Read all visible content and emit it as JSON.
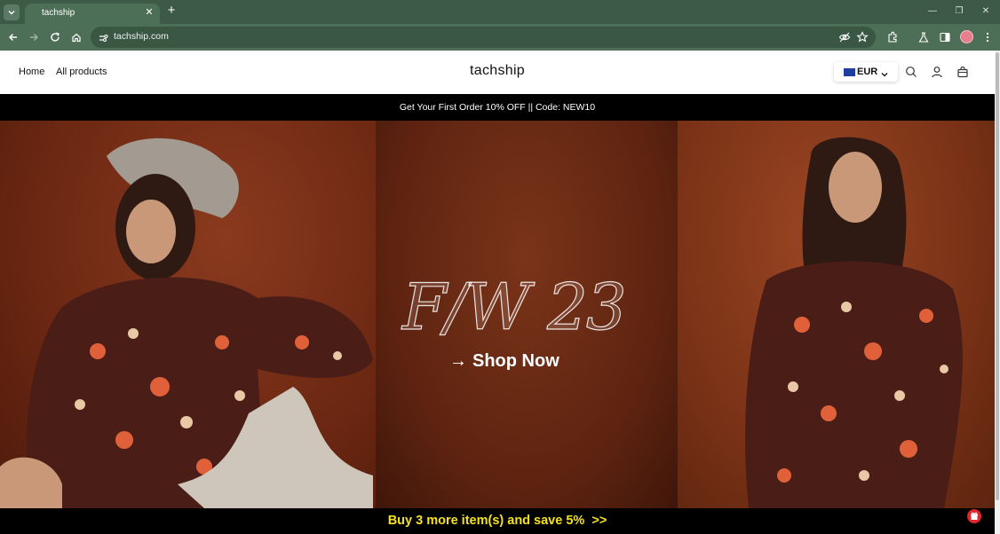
{
  "browser": {
    "tab_title": "tachship",
    "url": "tachship.com"
  },
  "header": {
    "nav": [
      "Home",
      "All products"
    ],
    "brand": "tachship",
    "currency": "EUR"
  },
  "announcement": "Get Your First Order 10% OFF || Code: NEW10",
  "hero": {
    "title": "F/W 23",
    "cta_arrow": "→",
    "cta": "Shop Now"
  },
  "promo_bar": "Buy 3 more item(s) and save 5%  >>",
  "colors": {
    "chrome": "#4d6f57",
    "promo_text": "#f4e11c",
    "hero_bg": "#6b2a17",
    "gift_button": "#e0262b"
  },
  "icons": [
    "tab-list-icon",
    "close-icon",
    "plus-icon",
    "minimize-icon",
    "restore-icon",
    "back-icon",
    "forward-icon",
    "reload-icon",
    "home-icon",
    "site-info-icon",
    "eye-off-icon",
    "star-icon",
    "extensions-icon",
    "labs-icon",
    "side-panel-icon",
    "menu-icon",
    "search-icon",
    "account-icon",
    "cart-icon",
    "gift-icon"
  ]
}
